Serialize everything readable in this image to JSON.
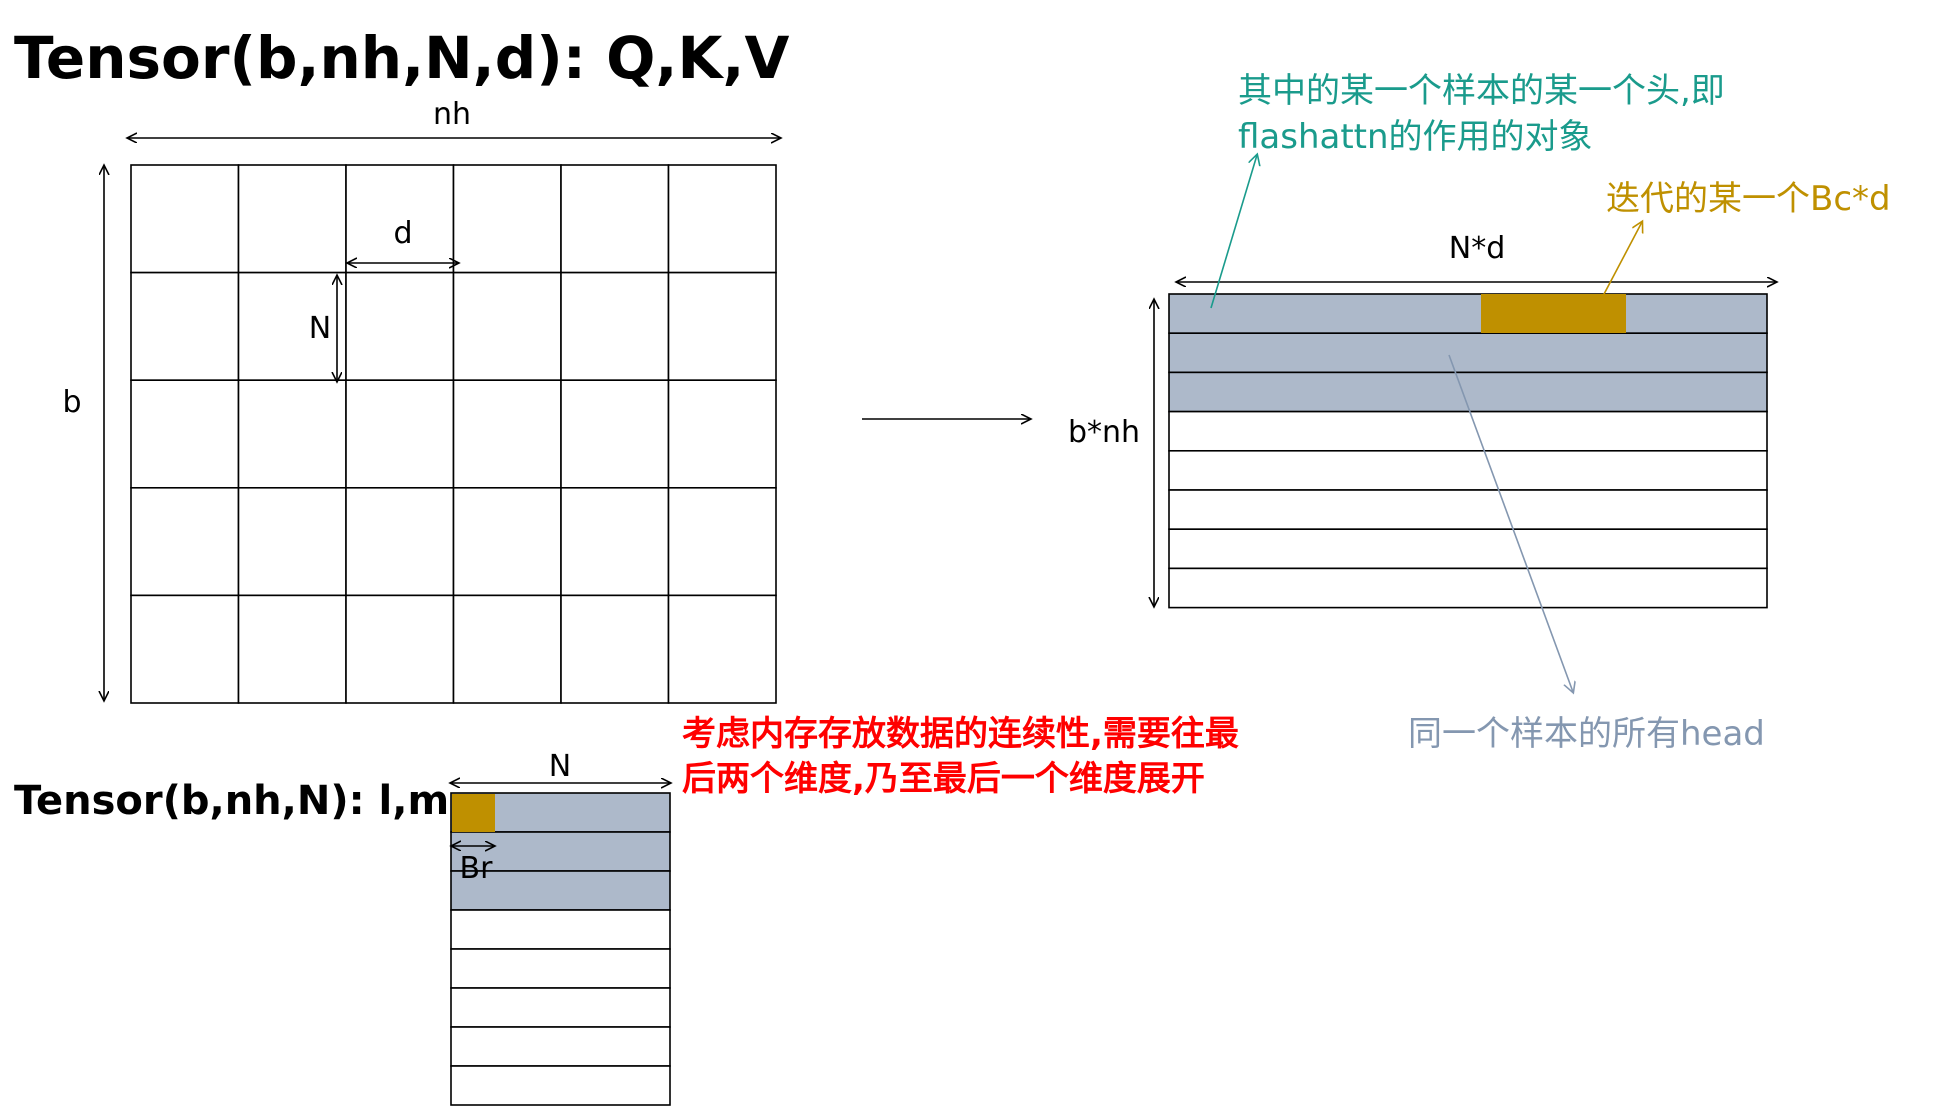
{
  "title_main": "Tensor(b,nh,N,d): Q,K,V",
  "title_lm": "Tensor(b,nh,N): l,m",
  "labels": {
    "nh": "nh",
    "b": "b",
    "d": "d",
    "N_cell": "N",
    "Nd": "N*d",
    "bnh": "b*nh",
    "N_lm": "N",
    "Br": "Br"
  },
  "annotations": {
    "one_head_line1": "其中的某一个样本的某一个头,即",
    "one_head_line2": "flashattn的作用的对象",
    "iter_block": "迭代的某一个Bc*d",
    "all_heads": "同一个样本的所有head",
    "note_line1": "考虑内存存放数据的连续性,需要往最",
    "note_line2": "后两个维度,乃至最后一个维度展开"
  },
  "grid": {
    "rows": 5,
    "cols": 6
  },
  "flattened": {
    "rows": 8,
    "highlighted_rows": 3
  },
  "lm_table": {
    "rows": 8,
    "highlighted_rows": 3
  },
  "colors": {
    "highlight": "#adb9ca",
    "block": "#bf9000",
    "teal": "#1a9b8c",
    "gold": "#bf9000",
    "slate": "#8497b0",
    "red": "#ff0000",
    "line": "#000000"
  }
}
